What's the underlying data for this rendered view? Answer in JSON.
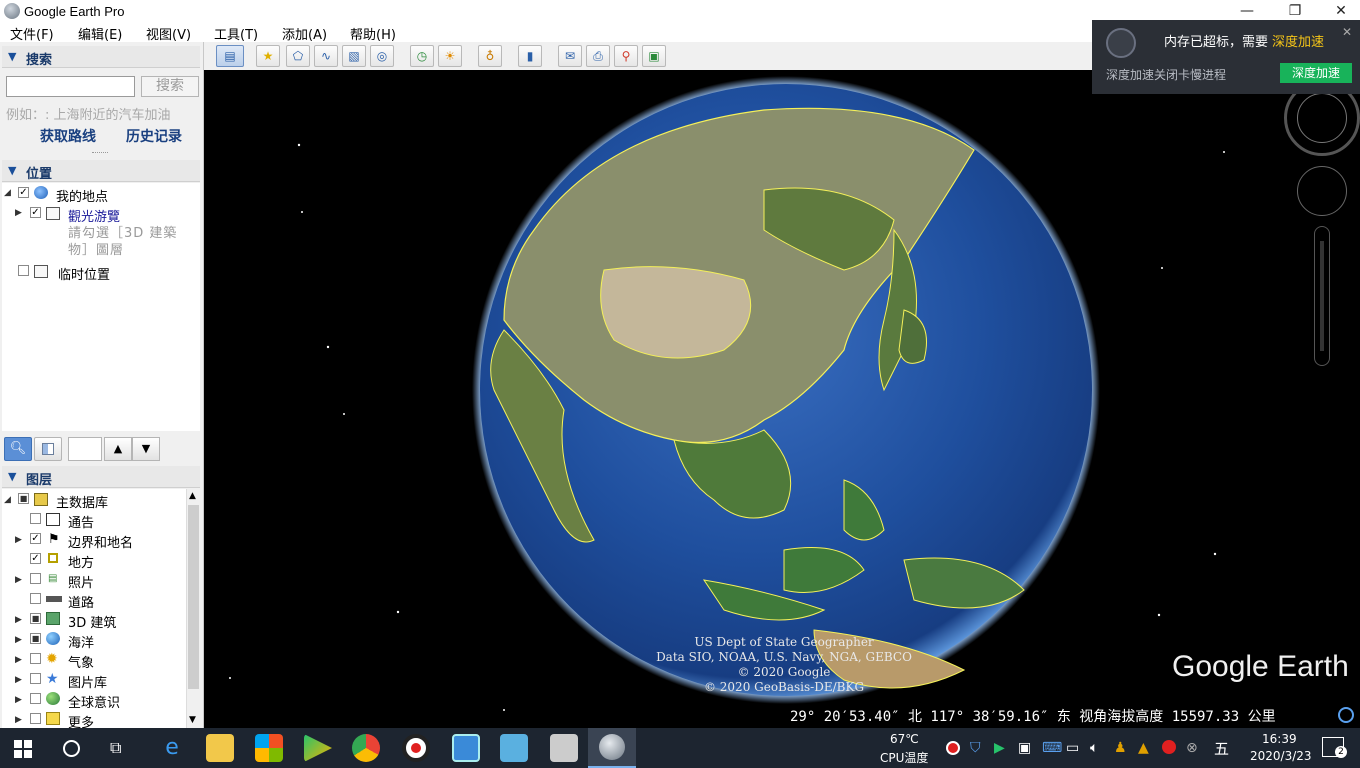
{
  "window": {
    "title": "Google Earth Pro",
    "controls": {
      "minimize": "—",
      "maximize": "❐",
      "close": "✕"
    }
  },
  "menu": [
    "文件(F)",
    "编辑(E)",
    "视图(V)",
    "工具(T)",
    "添加(A)",
    "帮助(H)"
  ],
  "search": {
    "header": "搜索",
    "input_value": "",
    "button": "搜索",
    "hint": "例如：: 上海附近的汽车加油",
    "get_directions": "获取路线",
    "history": "历史记录"
  },
  "places": {
    "header": "位置",
    "items": [
      {
        "label": "我的地点",
        "checked": "✓",
        "icon": "globe-icon"
      },
      {
        "label": "觀光游覽",
        "checked": "✓",
        "icon": "folder-icon"
      },
      {
        "label": "請勾選［3D 建築物］圖層"
      },
      {
        "label": "临时位置",
        "checked": "",
        "icon": "folder-icon"
      }
    ]
  },
  "layers": {
    "header": "图层",
    "items": [
      {
        "label": "主数据库",
        "checked": "■",
        "icon": "database-icon"
      },
      {
        "label": "通告",
        "checked": "",
        "icon": "envelope-icon"
      },
      {
        "label": "边界和地名",
        "checked": "✓",
        "icon": "flag-icon"
      },
      {
        "label": "地方",
        "checked": "✓",
        "icon": "places-icon"
      },
      {
        "label": "照片",
        "checked": "",
        "icon": "photo-icon"
      },
      {
        "label": "道路",
        "checked": "",
        "icon": "road-icon"
      },
      {
        "label": "3D 建筑",
        "checked": "■",
        "icon": "building-icon"
      },
      {
        "label": "海洋",
        "checked": "■",
        "icon": "ocean-icon"
      },
      {
        "label": "气象",
        "checked": "",
        "icon": "weather-icon"
      },
      {
        "label": "图片库",
        "checked": "",
        "icon": "gallery-icon"
      },
      {
        "label": "全球意识",
        "checked": "",
        "icon": "globe-awareness-icon"
      },
      {
        "label": "更多",
        "checked": "",
        "icon": "more-icon"
      }
    ]
  },
  "earth": {
    "attribution": [
      "US Dept of State Geographer",
      "Data SIO, NOAA, U.S. Navy, NGA, GEBCO",
      "© 2020 Google",
      "© 2020 GeoBasis-DE/BKG"
    ],
    "logo": "Google Earth",
    "status": "29° 20′53.40″ 北 117° 38′59.16″ 东 视角海拔高度 15597.33 公里"
  },
  "popup": {
    "title": "内存已超标，需要",
    "title_link": "深度加速",
    "subtitle": "深度加速关闭卡慢进程",
    "button": "深度加速",
    "close": "✕"
  },
  "taskbar": {
    "temp": "67℃",
    "temp_label": "CPU温度",
    "ime": "五",
    "time": "16:39",
    "date": "2020/3/23",
    "notifications": "2"
  }
}
